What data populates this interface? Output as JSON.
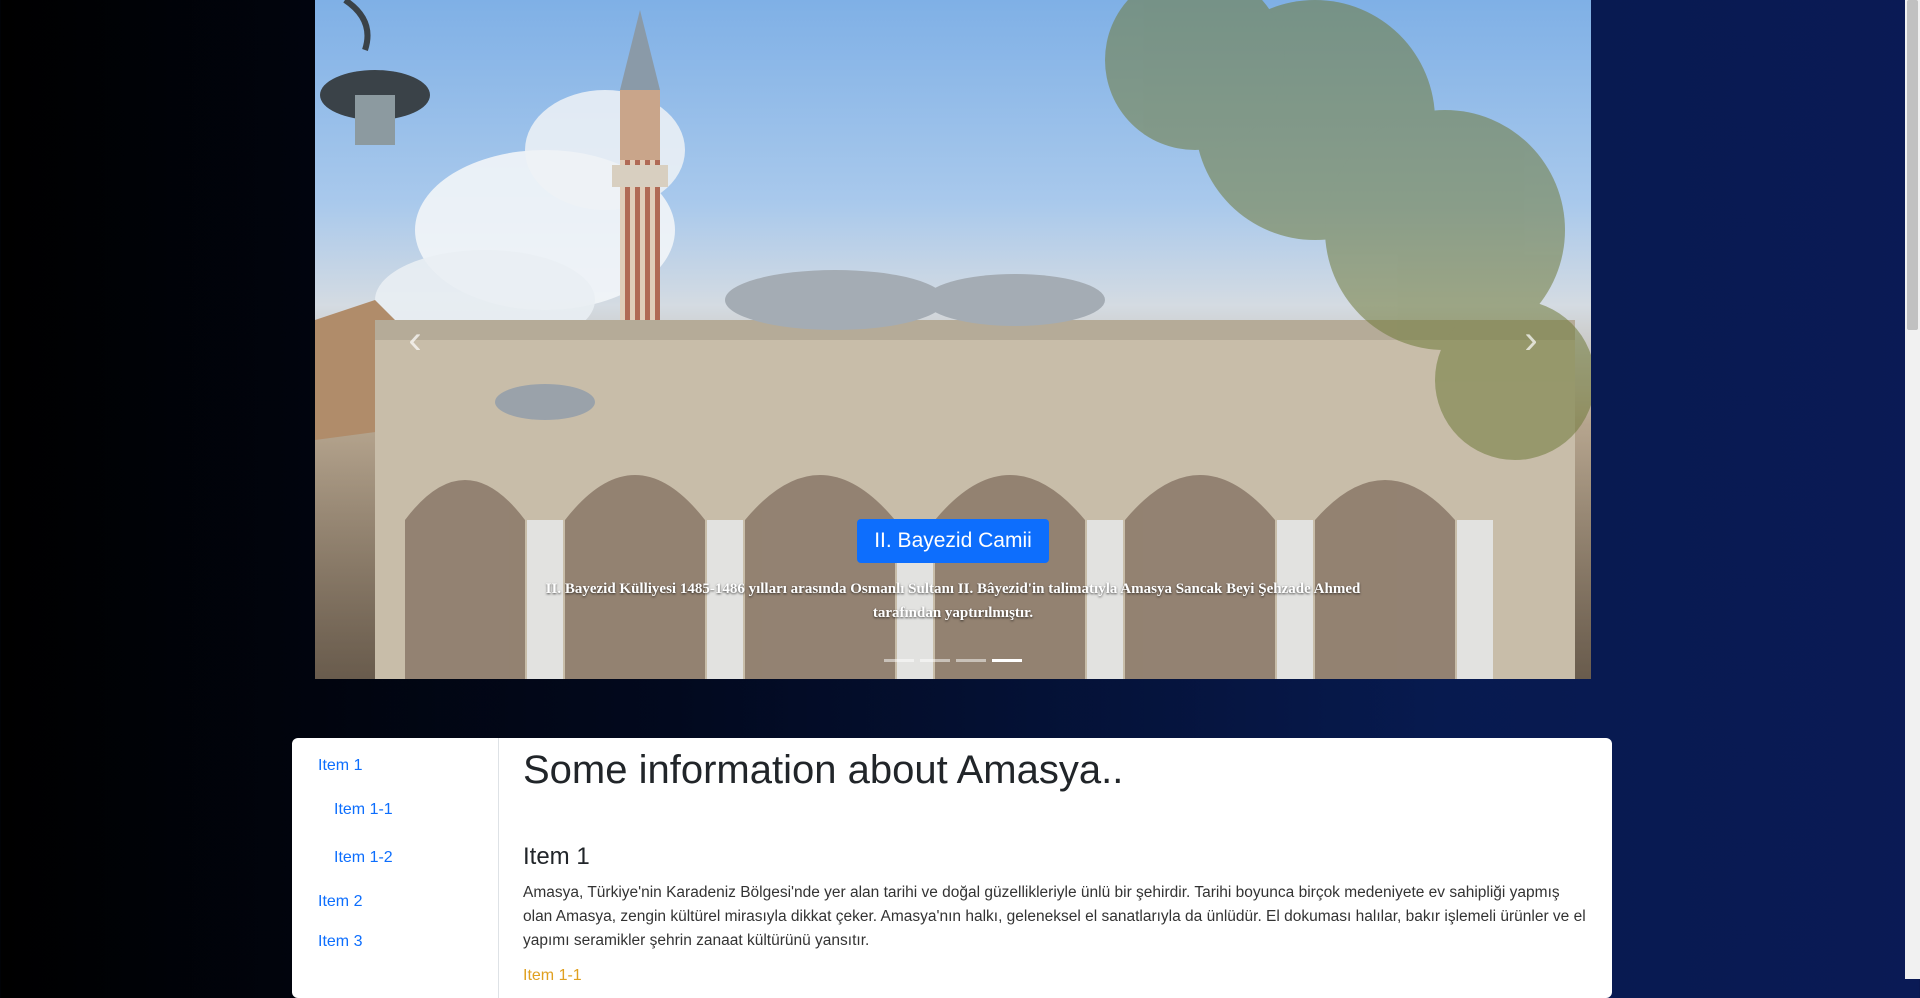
{
  "carousel": {
    "caption_title": "II. Bayezid Camii",
    "caption_text": "II. Bayezid Külliyesi 1485-1486 yılları arasında Osmanlı Sultanı II. Bâyezid'in talimatıyla Amasya Sancak Beyi Şehzade Ahmed tarafından yaptırılmıştır.",
    "prev_icon": "‹",
    "next_icon": "›",
    "indicator_count": 4,
    "active_indicator": 4
  },
  "sidebar": {
    "items": [
      {
        "label": "Item 1"
      },
      {
        "label": "Item 1-1"
      },
      {
        "label": "Item 1-2"
      },
      {
        "label": "Item 2"
      },
      {
        "label": "Item 3"
      }
    ]
  },
  "main": {
    "title": "Some information about Amasya..",
    "section_title": "Item 1",
    "section_text": "Amasya, Türkiye'nin Karadeniz Bölgesi'nde yer alan tarihi ve doğal güzellikleriyle ünlü bir şehirdir. Tarihi boyunca birçok medeniyete ev sahipliği yapmış olan Amasya, zengin kültürel mirasıyla dikkat çeker. Amasya'nın halkı, geleneksel el sanatlarıyla da ünlüdür. El dokuması halılar, bakır işlemeli ürünler ve el yapımı seramikler şehrin zanaat kültürünü yansıtır.",
    "sub_heading": "Item 1-1"
  },
  "colors": {
    "accent": "#0d6efd",
    "sub_heading": "#e0a020"
  }
}
